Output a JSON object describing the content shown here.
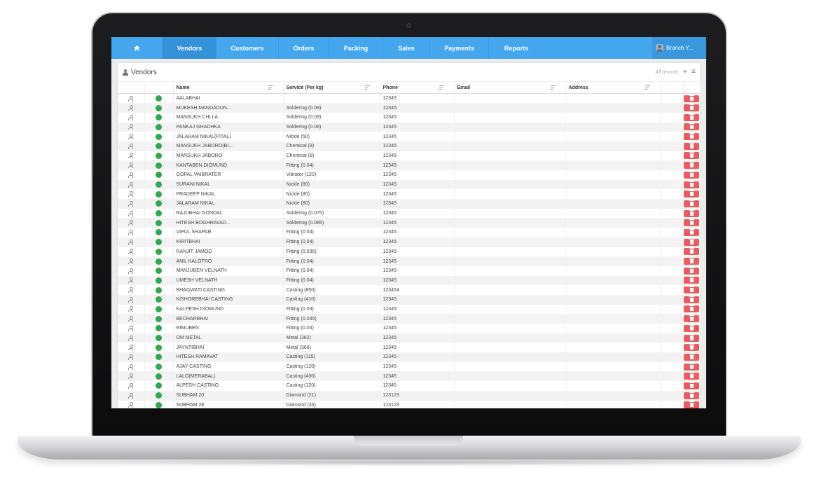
{
  "nav": {
    "home_icon": "home-icon",
    "items": [
      {
        "label": "Vendors",
        "active": true,
        "width": 76
      },
      {
        "label": "Customers",
        "active": false,
        "width": 89
      },
      {
        "label": "Orders",
        "active": false,
        "width": 72
      },
      {
        "label": "Packing",
        "active": false,
        "width": 77
      },
      {
        "label": "Sales",
        "active": false,
        "width": 67
      },
      {
        "label": "Payments",
        "active": false,
        "width": 84
      },
      {
        "label": "Reports",
        "active": false,
        "width": 79
      }
    ],
    "branch_label": "Branch Y..."
  },
  "panel": {
    "title": "Vendors",
    "records": "43 records",
    "add_label": "+",
    "filter_label": "≡"
  },
  "columns": [
    {
      "label": "",
      "width": 38,
      "sortable": false
    },
    {
      "label": "",
      "width": 41,
      "sortable": false
    },
    {
      "label": "Name",
      "width": 157,
      "sortable": true
    },
    {
      "label": "Service (Per kg)",
      "width": 138,
      "sortable": true
    },
    {
      "label": "Phone",
      "width": 106,
      "sortable": true
    },
    {
      "label": "Email",
      "width": 159,
      "sortable": true
    },
    {
      "label": "Address",
      "width": 135,
      "sortable": true
    },
    {
      "label": "",
      "width": 33,
      "sortable": false
    },
    {
      "label": "",
      "width": 24,
      "sortable": false
    }
  ],
  "rows": [
    {
      "name": "AALABHAI",
      "service": "",
      "phone": "12345"
    },
    {
      "name": "MUKESH MANDADUN...",
      "service": "Soldering (0.09)",
      "phone": "12345"
    },
    {
      "name": "MANSUKH CHLLA",
      "service": "Soldering (0.09)",
      "phone": "12345"
    },
    {
      "name": "PANKAJ GHADHKA",
      "service": "Soldering (0.08)",
      "phone": "12345"
    },
    {
      "name": "JALARAM NIKAL(PITAL)",
      "service": "Nickle (50)",
      "phone": "12345"
    },
    {
      "name": "MANSUKH JABORO(BI...",
      "service": "Chemical (8)",
      "phone": "12345"
    },
    {
      "name": "MANSUKH JABORO",
      "service": "Chemical (8)",
      "phone": "12345"
    },
    {
      "name": "KANTABEN DIOMUND",
      "service": "Fitting (0.04)",
      "phone": "12345"
    },
    {
      "name": "GOPAL VAIBRATER",
      "service": "Vibrator (120)",
      "phone": "12345"
    },
    {
      "name": "SURANI NIKAL",
      "service": "Nickle (80)",
      "phone": "12345"
    },
    {
      "name": "PRADEEP NIKAL",
      "service": "Nickle (80)",
      "phone": "12345"
    },
    {
      "name": "JALARAM NIKAL",
      "service": "Nickle (80)",
      "phone": "12345"
    },
    {
      "name": "RAJUBHAI GONDAL",
      "service": "Soldering (0.075)",
      "phone": "12345"
    },
    {
      "name": "HITESH BOGHRAVAD...",
      "service": "Soldering (0.085)",
      "phone": "12345"
    },
    {
      "name": "VIPUL SHAPAR",
      "service": "Fitting (0.04)",
      "phone": "12345"
    },
    {
      "name": "KIRITBHAI",
      "service": "Fitting (0.04)",
      "phone": "12345"
    },
    {
      "name": "RANJIT JAMOD",
      "service": "Fitting (0.035)",
      "phone": "12345"
    },
    {
      "name": "ANIL KALOTRO",
      "service": "Fitting (0.04)",
      "phone": "12345"
    },
    {
      "name": "MANJUBEN VELNATH",
      "service": "Fitting (0.04)",
      "phone": "12345"
    },
    {
      "name": "UMESH VELNATH",
      "service": "Fitting (0.04)",
      "phone": "12345"
    },
    {
      "name": "BHAGWATI CASTING",
      "service": "Casting (850)",
      "phone": "123454"
    },
    {
      "name": "KISHOREBHAI CASTING",
      "service": "Casting (410)",
      "phone": "12345"
    },
    {
      "name": "KALPESH DIOMUND",
      "service": "Fitting (0.03)",
      "phone": "12345"
    },
    {
      "name": "BECHARBHAI",
      "service": "Fitting (0.035)",
      "phone": "12345"
    },
    {
      "name": "RIMUBEN",
      "service": "Fitting (0.04)",
      "phone": "12345"
    },
    {
      "name": "OM METAL",
      "service": "Metal (362)",
      "phone": "12345"
    },
    {
      "name": "JAYNTIBHAI",
      "service": "Metal (366)",
      "phone": "12345"
    },
    {
      "name": "HITESH RAMAVAT",
      "service": "Casting (115)",
      "phone": "12345"
    },
    {
      "name": "AJAY CASTING",
      "service": "Casting (120)",
      "phone": "12345"
    },
    {
      "name": "LALO(MERABAL)",
      "service": "Casting (430)",
      "phone": "12345"
    },
    {
      "name": "ALPESH CASTING",
      "service": "Casting (120)",
      "phone": "12345"
    },
    {
      "name": "SUBHAM 20",
      "service": "Diamond (21)",
      "phone": "123123"
    },
    {
      "name": "SUBHAM 28",
      "service": "Diamond (35)",
      "phone": "123123"
    }
  ],
  "colors": {
    "nav_bg": "#44a7ee",
    "nav_active": "#3592d9",
    "status_active": "#2fa84f",
    "delete_button": "#ec5b5f"
  }
}
